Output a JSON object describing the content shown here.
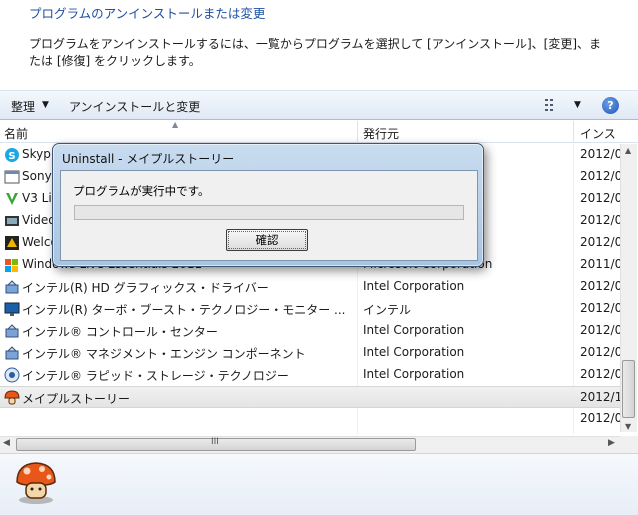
{
  "header": {
    "title": "プログラムのアンインストールまたは変更",
    "description": "プログラムをアンインストールするには、一覧からプログラムを選択して [アンインストール]、[変更]、または [修復] をクリックします。"
  },
  "toolbar": {
    "organize_label": "整理",
    "uninstall_change_label": "アンインストールと変更",
    "help_glyph": "?"
  },
  "columns": {
    "name": "名前",
    "publisher": "発行元",
    "installed": "インス"
  },
  "rows": [
    {
      "name": "Skyp",
      "publisher": "",
      "date": "2012/0",
      "icon": "skype-icon"
    },
    {
      "name": "Sony",
      "publisher": "",
      "date": "2012/0",
      "icon": "window-icon"
    },
    {
      "name": "V3 Li",
      "publisher": "",
      "date": "2012/0",
      "icon": "v3-icon"
    },
    {
      "name": "Video",
      "publisher": "",
      "date": "2012/0",
      "icon": "video-icon"
    },
    {
      "name": "Welco",
      "publisher": "",
      "date": "2012/0",
      "icon": "welcome-icon"
    },
    {
      "name": "Windows Live Essentials 2011",
      "publisher": "Microsoft Corporation",
      "date": "2011/0",
      "icon": "windows-flag-icon"
    },
    {
      "name": "インテル(R) HD グラフィックス・ドライバー",
      "publisher": "Intel Corporation",
      "date": "2012/0",
      "icon": "installer-icon"
    },
    {
      "name": "インテル(R) ターボ・ブースト・テクノロジー・モニター ...",
      "publisher": "インテル",
      "date": "2012/0",
      "icon": "monitor-icon"
    },
    {
      "name": "インテル® コントロール・センター",
      "publisher": "Intel Corporation",
      "date": "2012/0",
      "icon": "installer-icon"
    },
    {
      "name": "インテル® マネジメント・エンジン コンポーネント",
      "publisher": "Intel Corporation",
      "date": "2012/0",
      "icon": "installer-icon"
    },
    {
      "name": "インテル® ラピッド・ストレージ・テクノロジー",
      "publisher": "Intel Corporation",
      "date": "2012/0",
      "icon": "storage-icon"
    },
    {
      "name": "メイプルストーリー",
      "publisher": "",
      "date": "2012/1",
      "icon": "mushroom-icon",
      "selected": true
    },
    {
      "name": "",
      "publisher": "",
      "date": "2012/0",
      "icon": ""
    }
  ],
  "dialog": {
    "title": "Uninstall - メイプルストーリー",
    "message": "プログラムが実行中です。",
    "progress": 0,
    "ok_label": "確認"
  },
  "hscroll_grip": "III"
}
